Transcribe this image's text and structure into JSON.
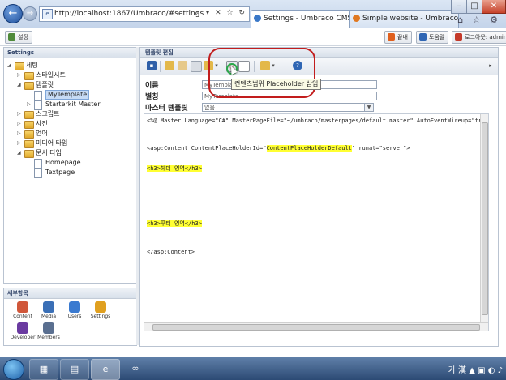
{
  "browser": {
    "back_icon": "←",
    "forward_icon": "→",
    "url": "http://localhost:1867/Umbraco/#settings",
    "addr_tools": "⌕ ▾ ✕ ☆ ↻",
    "tabs": [
      {
        "label": "Settings - Umbraco CMS -...",
        "close": "✕"
      },
      {
        "label": "Simple website - Umbraco C...",
        "close": ""
      }
    ],
    "window_buttons": {
      "min": "–",
      "max": "□",
      "close": "✕"
    },
    "tools_icons": "⌂ ☆ ⚙"
  },
  "app_header": {
    "left_button": "설정",
    "help_button": "도움말",
    "logout_button": "로그아웃: admin",
    "orange_button": "끝내"
  },
  "left_panel": {
    "title": "Settings",
    "tree": [
      {
        "label": "세팅",
        "level": 0,
        "arrow": "◢",
        "icon": "folder"
      },
      {
        "label": "스타일시트",
        "level": 1,
        "arrow": "▷",
        "icon": "folder"
      },
      {
        "label": "템플릿",
        "level": 1,
        "arrow": "◢",
        "icon": "folder"
      },
      {
        "label": "MyTemplate",
        "level": 2,
        "arrow": "",
        "icon": "doc",
        "selected": true
      },
      {
        "label": "Starterkit Master",
        "level": 2,
        "arrow": "▷",
        "icon": "doc"
      },
      {
        "label": "스크립트",
        "level": 1,
        "arrow": "▷",
        "icon": "folder"
      },
      {
        "label": "사전",
        "level": 1,
        "arrow": "▷",
        "icon": "folder"
      },
      {
        "label": "언어",
        "level": 1,
        "arrow": "▷",
        "icon": "folder"
      },
      {
        "label": "미디어 타입",
        "level": 1,
        "arrow": "▷",
        "icon": "folder"
      },
      {
        "label": "문서 타입",
        "level": 1,
        "arrow": "◢",
        "icon": "folder"
      },
      {
        "label": "Homepage",
        "level": 2,
        "arrow": "",
        "icon": "doc"
      },
      {
        "label": "Textpage",
        "level": 2,
        "arrow": "",
        "icon": "doc"
      }
    ]
  },
  "sections_panel": {
    "title": "세부항목",
    "items": [
      {
        "label": "Content",
        "color": "#d0573a"
      },
      {
        "label": "Media",
        "color": "#3a6fb6"
      },
      {
        "label": "Users",
        "color": "#3a7ad0"
      },
      {
        "label": "Settings",
        "color": "#e0a020"
      },
      {
        "label": "Developer",
        "color": "#6a3aa0"
      },
      {
        "label": "Members",
        "color": "#5a6f90"
      }
    ]
  },
  "editor_panel": {
    "title": "템플릿 편집",
    "tooltip": "컨텐츠범위 Placeholder 삽입",
    "help_icon": "?",
    "fields": {
      "name_label": "이름",
      "name_value": "MyTemplate",
      "alias_label": "별칭",
      "alias_value": "MyTemplate",
      "master_label": "마스터 템플릿",
      "master_value": "없음"
    },
    "code": {
      "line1": "<%@ Master Language=\"C#\" MasterPageFile=\"~/umbraco/masterpages/default.master\" AutoEventWireup=\"true\" %>",
      "line2_pre": "<asp:Content ContentPlaceHolderId=\"",
      "line2_hl": "ContentPlaceHolderDefault",
      "line2_post": "\" runat=\"server\">",
      "line3": "<h3>헤더 영역</h3>",
      "line4": "<h3>푸터 영역</h3>",
      "line5": "</asp:Content>"
    }
  },
  "taskbar": {
    "tray_text": "가 漢"
  },
  "colors": {
    "highlight_ring": "#c21d1d",
    "code_highlight": "#ffff33",
    "tree_selected": "#c7dbf5"
  }
}
